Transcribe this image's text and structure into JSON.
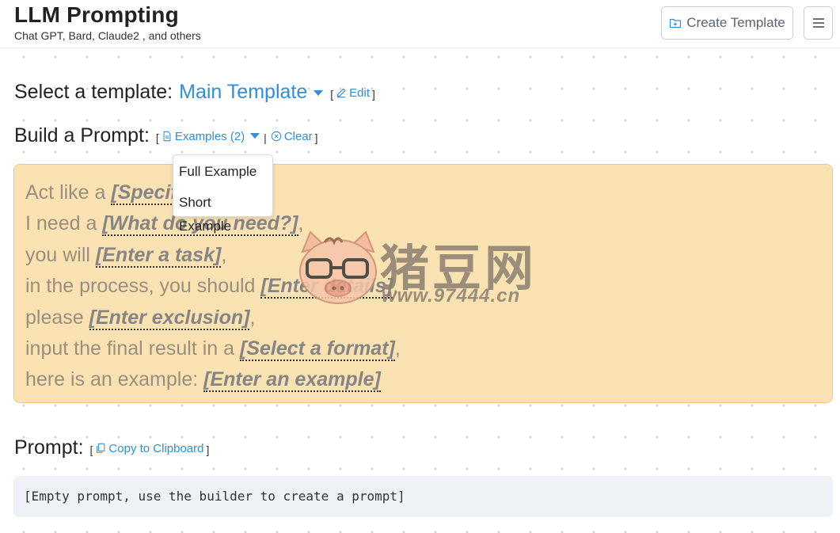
{
  "header": {
    "title": "LLM Prompting",
    "subtitle": "Chat GPT, Bard, Claude2 , and others",
    "create_template_label": "Create Template"
  },
  "template_select": {
    "label": "Select a template:",
    "selected": "Main Template",
    "edit_label": "Edit"
  },
  "builder": {
    "label": "Build a Prompt:",
    "examples_label": "Examples (2)",
    "clear_label": "Clear",
    "examples_menu": [
      "Full Example",
      "Short Example"
    ],
    "lines": [
      {
        "pre": "Act like a ",
        "field": "[Specify a role]",
        "post": ","
      },
      {
        "pre": "I need a ",
        "field": "[What do you need?]",
        "post": ","
      },
      {
        "pre": "you will ",
        "field": "[Enter a task]",
        "post": ","
      },
      {
        "pre": "in the process, you should ",
        "field": "[Enter details]",
        "post": ","
      },
      {
        "pre": "please ",
        "field": "[Enter exclusion]",
        "post": ","
      },
      {
        "pre": "input the final result in a ",
        "field": "[Select a format]",
        "post": ","
      },
      {
        "pre": "here is an example: ",
        "field": "[Enter an example]",
        "post": ""
      }
    ]
  },
  "prompt": {
    "label": "Prompt:",
    "copy_label": "Copy to Clipboard",
    "placeholder": "[Empty prompt, use the builder to create a prompt]"
  },
  "watermark": {
    "text": "猪豆网",
    "url": "www.97444.cn"
  },
  "colors": {
    "link": "#2f8fd8",
    "builder_bg": "#fbe2b3",
    "prompt_bg": "#eef1f5"
  }
}
